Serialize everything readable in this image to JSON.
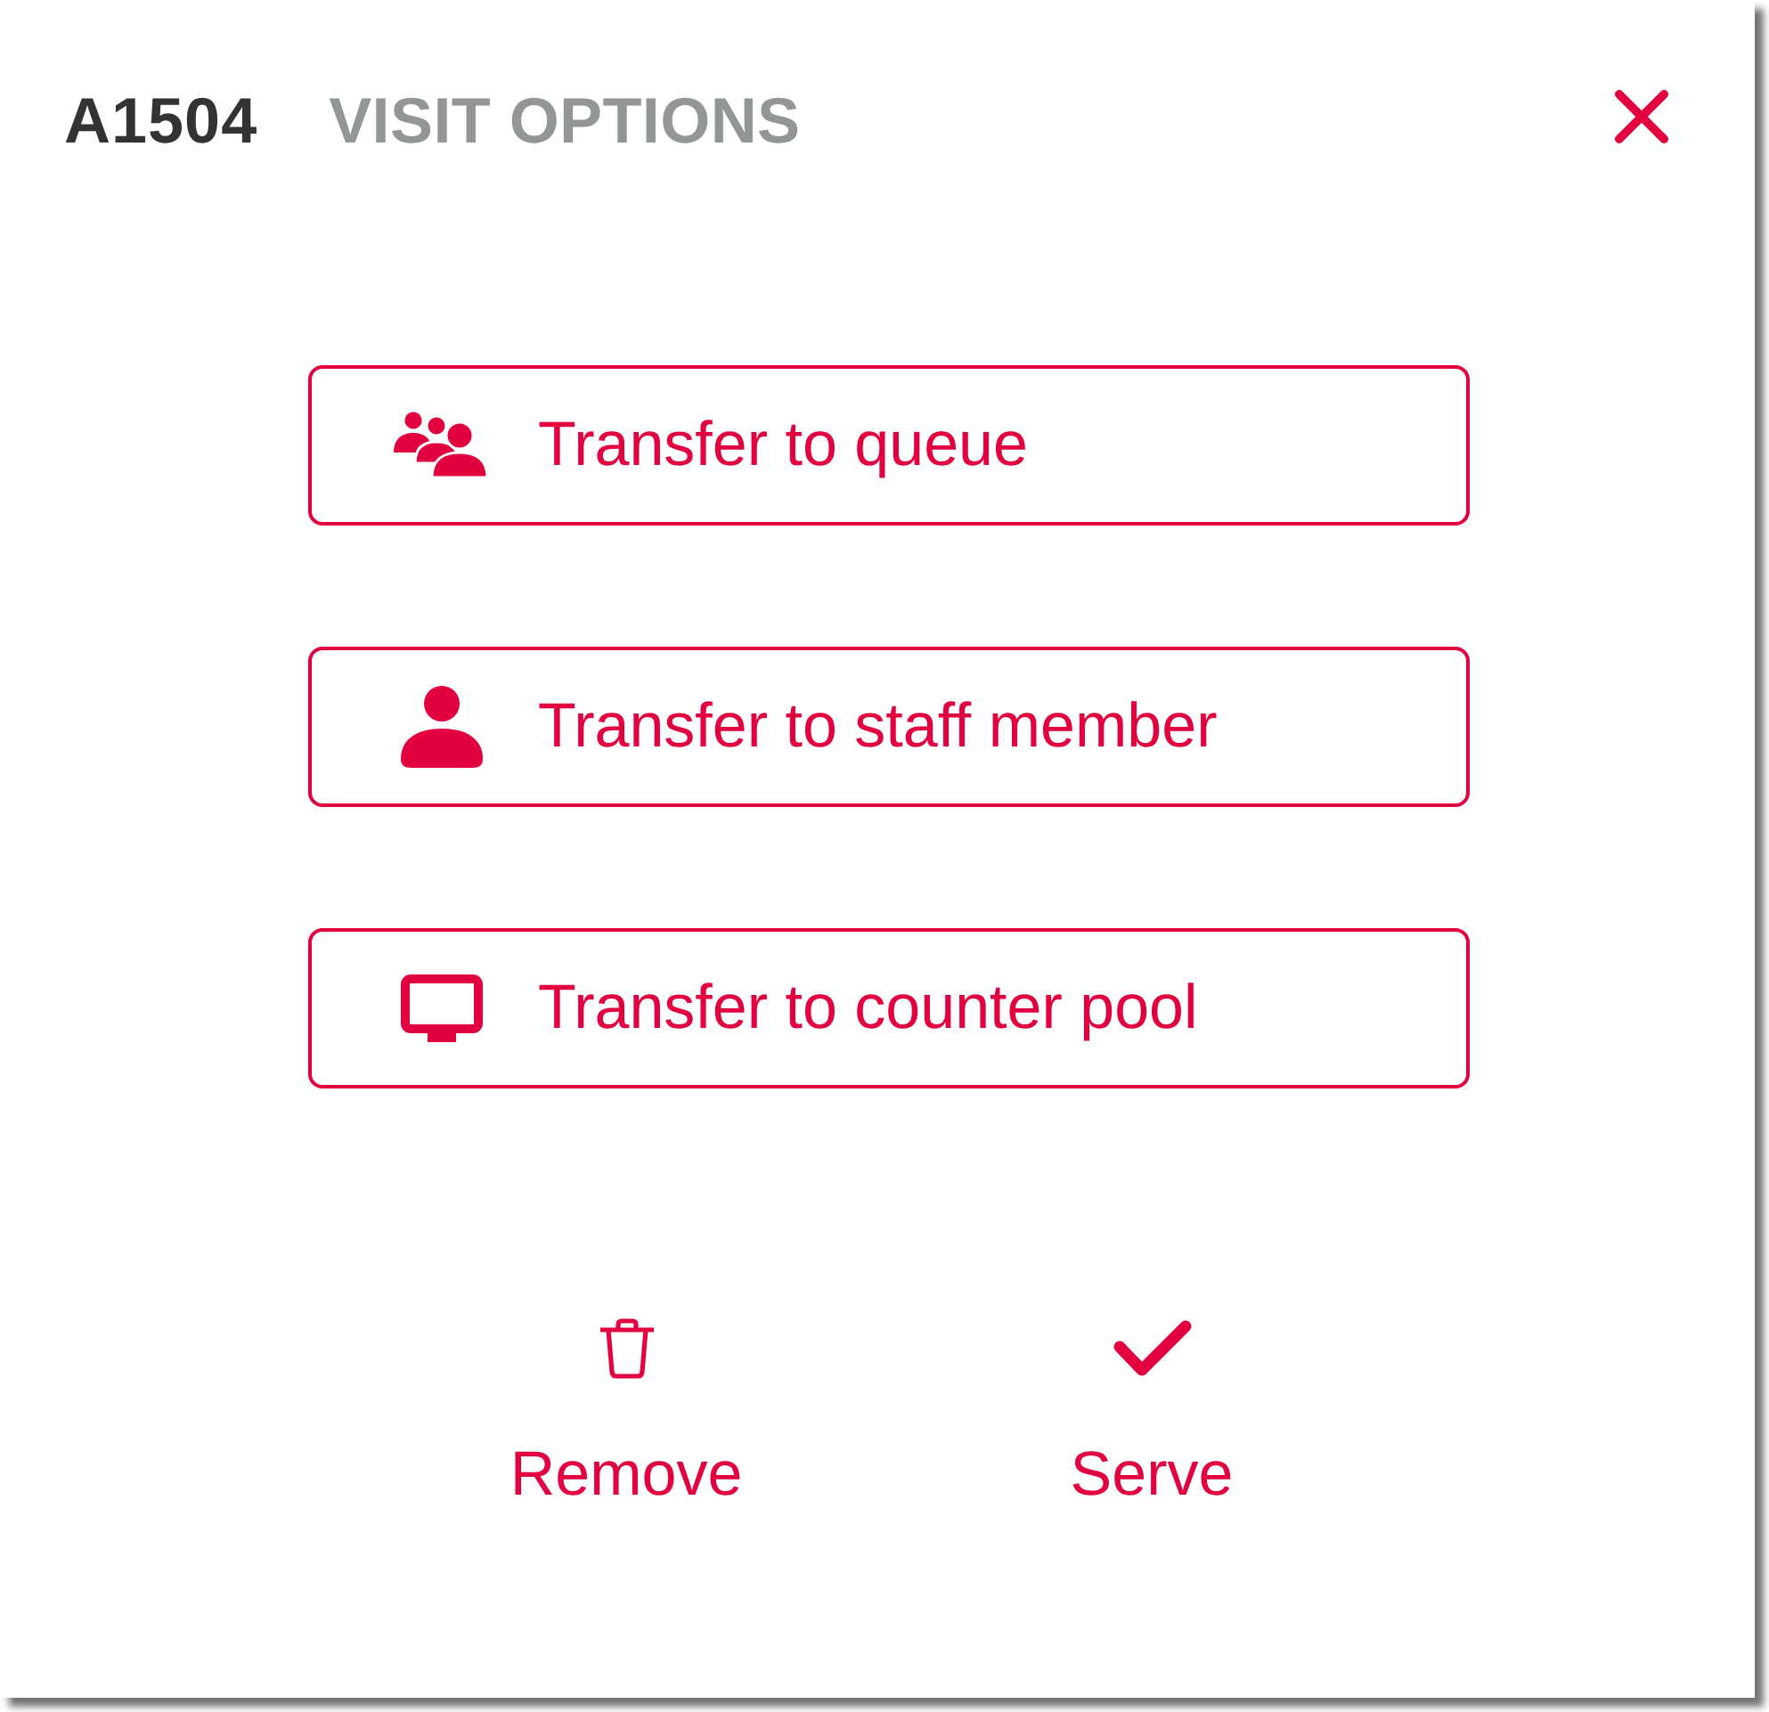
{
  "dialog": {
    "ticket": "A1504",
    "title": "VISIT OPTIONS"
  },
  "transfer_actions": [
    {
      "kind": "queue",
      "label": "Transfer to queue"
    },
    {
      "kind": "staff",
      "label": "Transfer to staff member"
    },
    {
      "kind": "counter",
      "label": "Transfer to counter pool"
    }
  ],
  "footer_actions": [
    {
      "kind": "remove",
      "label": "Remove"
    },
    {
      "kind": "serve",
      "label": "Serve"
    }
  ]
}
